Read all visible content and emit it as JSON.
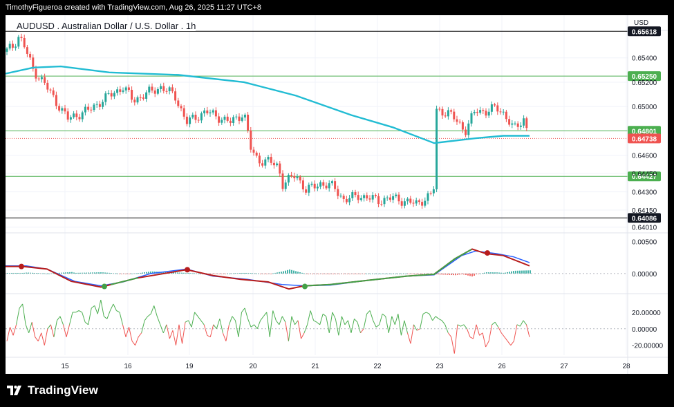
{
  "header": {
    "attribution": "TimothyFigueroa created with TradingView.com, Aug 26, 2025 11:27 UTC+8"
  },
  "symbol": {
    "title": "AUDUSD . Australian Dollar / U.S. Dollar . 1h",
    "currency": "USD"
  },
  "footer": {
    "brand": "TradingView"
  },
  "colors": {
    "up": "#26a69a",
    "down": "#ef5350",
    "ma": "#22bcd3",
    "level_green": "#4caf50",
    "level_black": "#000000",
    "macd": "#2962ff",
    "signal": "#b71c1c",
    "macd_hl": "#43a047",
    "osc_up": "#4caf50",
    "osc_down": "#ef5350"
  },
  "chart_data": [
    {
      "type": "line",
      "name": "price",
      "x_ticks": [
        "15",
        "16",
        "19",
        "20",
        "21",
        "22",
        "23",
        "26",
        "27",
        "28"
      ],
      "y_ticks": [
        "0.65400",
        "0.65200",
        "0.65000",
        "0.64600",
        "0.64450",
        "0.64300",
        "0.64150",
        "0.64010"
      ],
      "ylim": [
        0.6398,
        0.6575
      ],
      "close_path": [
        [
          0,
          0.6545
        ],
        [
          12,
          0.655
        ],
        [
          18,
          0.6558
        ],
        [
          25,
          0.6553
        ],
        [
          40,
          0.653
        ],
        [
          55,
          0.652
        ],
        [
          72,
          0.6505
        ],
        [
          90,
          0.649
        ],
        [
          120,
          0.6497
        ],
        [
          150,
          0.6509
        ],
        [
          170,
          0.6516
        ],
        [
          185,
          0.6505
        ],
        [
          205,
          0.6511
        ],
        [
          225,
          0.6516
        ],
        [
          245,
          0.6509
        ],
        [
          262,
          0.6487
        ],
        [
          290,
          0.6496
        ],
        [
          325,
          0.6487
        ],
        [
          345,
          0.6495
        ],
        [
          350,
          0.648
        ],
        [
          355,
          0.6465
        ],
        [
          365,
          0.6456
        ],
        [
          380,
          0.6455
        ],
        [
          395,
          0.6451
        ],
        [
          400,
          0.6436
        ],
        [
          420,
          0.6444
        ],
        [
          435,
          0.6431
        ],
        [
          455,
          0.6437
        ],
        [
          475,
          0.6434
        ],
        [
          490,
          0.6423
        ],
        [
          510,
          0.6427
        ],
        [
          540,
          0.6423
        ],
        [
          560,
          0.6425
        ],
        [
          580,
          0.6422
        ],
        [
          595,
          0.642
        ],
        [
          605,
          0.6424
        ],
        [
          615,
          0.6427
        ],
        [
          620,
          0.6434
        ],
        [
          622,
          0.6497
        ],
        [
          640,
          0.6495
        ],
        [
          655,
          0.6487
        ],
        [
          665,
          0.648
        ],
        [
          680,
          0.6497
        ],
        [
          695,
          0.6496
        ],
        [
          710,
          0.6499
        ],
        [
          722,
          0.6494
        ],
        [
          735,
          0.6481
        ],
        [
          750,
          0.649
        ],
        [
          758,
          0.6474
        ]
      ],
      "ma_path": [
        [
          0,
          0.6527
        ],
        [
          40,
          0.6532
        ],
        [
          80,
          0.6533
        ],
        [
          150,
          0.6528
        ],
        [
          250,
          0.6526
        ],
        [
          345,
          0.652
        ],
        [
          420,
          0.6509
        ],
        [
          500,
          0.6493
        ],
        [
          560,
          0.6483
        ],
        [
          620,
          0.647
        ],
        [
          680,
          0.6474
        ],
        [
          720,
          0.6476
        ],
        [
          758,
          0.6476
        ]
      ],
      "levels": [
        {
          "label": "0.65618",
          "value": 0.65618,
          "style": "black"
        },
        {
          "label": "0.65250",
          "value": 0.6525,
          "style": "green"
        },
        {
          "label": "0.64801",
          "value": 0.64801,
          "style": "green"
        },
        {
          "label": "0.64738",
          "value": 0.64738,
          "style": "red"
        },
        {
          "label": "0.64427",
          "value": 0.64427,
          "style": "green"
        },
        {
          "label": "0.64086",
          "value": 0.64086,
          "style": "black"
        }
      ]
    },
    {
      "type": "line",
      "name": "macd",
      "y_ticks": [
        "0.00500",
        "0.00000"
      ],
      "ylim": [
        -0.0028,
        0.006
      ],
      "macd_path": [
        [
          0,
          0.0012
        ],
        [
          30,
          0.0012
        ],
        [
          60,
          0.0007
        ],
        [
          100,
          -0.0012
        ],
        [
          138,
          -0.0019
        ],
        [
          170,
          -0.0013
        ],
        [
          210,
          0.0
        ],
        [
          262,
          0.0007
        ],
        [
          300,
          -0.0004
        ],
        [
          350,
          -0.0009
        ],
        [
          400,
          -0.0017
        ],
        [
          432,
          -0.0019
        ],
        [
          470,
          -0.0018
        ],
        [
          520,
          -0.0011
        ],
        [
          580,
          -0.0004
        ],
        [
          620,
          -0.0002
        ],
        [
          660,
          0.0028
        ],
        [
          680,
          0.0035
        ],
        [
          710,
          0.0031
        ],
        [
          735,
          0.0026
        ],
        [
          758,
          0.0017
        ]
      ],
      "signal_path": [
        [
          0,
          0.0011
        ],
        [
          25,
          0.0011
        ],
        [
          60,
          0.0007
        ],
        [
          95,
          -0.0012
        ],
        [
          138,
          -0.0021
        ],
        [
          190,
          -0.0007
        ],
        [
          262,
          0.0006
        ],
        [
          300,
          -0.0003
        ],
        [
          340,
          -0.0009
        ],
        [
          380,
          -0.0013
        ],
        [
          410,
          -0.0024
        ],
        [
          432,
          -0.0019
        ],
        [
          470,
          -0.0017
        ],
        [
          520,
          -0.0011
        ],
        [
          580,
          -0.0004
        ],
        [
          620,
          -0.0001
        ],
        [
          650,
          0.0023
        ],
        [
          675,
          0.0038
        ],
        [
          695,
          0.0031
        ],
        [
          720,
          0.0028
        ],
        [
          758,
          0.0012
        ]
      ],
      "markers": [
        {
          "x": 23,
          "value": 0.0011,
          "kind": "down"
        },
        {
          "x": 143,
          "value": -0.002,
          "kind": "up"
        },
        {
          "x": 263,
          "value": 0.0006,
          "kind": "down"
        },
        {
          "x": 433,
          "value": -0.002,
          "kind": "up"
        },
        {
          "x": 697,
          "value": 0.0032,
          "kind": "down"
        }
      ]
    },
    {
      "type": "line",
      "name": "oscillator",
      "y_ticks": [
        "20.00000",
        "0.00000",
        "-20.00000"
      ],
      "ylim": [
        -32,
        40
      ],
      "values": [
        -15,
        2,
        -8,
        5,
        25,
        30,
        5,
        -5,
        8,
        -10,
        -15,
        -5,
        -20,
        0,
        5,
        -10,
        10,
        15,
        5,
        -10,
        5,
        20,
        20,
        22,
        20,
        8,
        5,
        25,
        28,
        18,
        35,
        15,
        12,
        22,
        30,
        22,
        20,
        5,
        -10,
        2,
        -15,
        -20,
        -10,
        -5,
        10,
        15,
        18,
        28,
        15,
        5,
        -5,
        5,
        -12,
        -2,
        -20,
        5,
        -18,
        8,
        10,
        2,
        20,
        15,
        10,
        5,
        -8,
        -10,
        5,
        0,
        12,
        -5,
        -15,
        5,
        15,
        10,
        -10,
        20,
        25,
        12,
        2,
        5,
        0,
        10,
        15,
        20,
        -10,
        22,
        10,
        5,
        15,
        8,
        -15,
        15,
        5,
        10,
        -12,
        -5,
        5,
        22,
        10,
        8,
        5,
        18,
        15,
        -5,
        20,
        12,
        -8,
        15,
        5,
        10,
        -5,
        12,
        8,
        -5,
        0,
        18,
        22,
        10,
        2,
        5,
        18,
        15,
        -5,
        15,
        5,
        18,
        -8,
        10,
        -5,
        -18,
        5,
        -2,
        0,
        18,
        20,
        18,
        10,
        15,
        12,
        10,
        5,
        -5,
        -10,
        -30,
        5,
        3,
        5,
        0,
        -10,
        -12,
        5,
        -8,
        -5,
        -22,
        -15,
        5,
        8,
        2,
        -5,
        -10,
        -15,
        -20,
        -15,
        5,
        3,
        10,
        5,
        -10
      ]
    }
  ]
}
